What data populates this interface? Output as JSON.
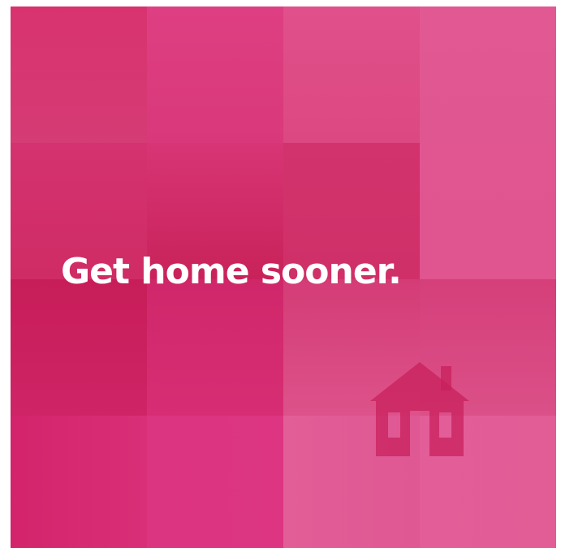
{
  "headline": "Get home sooner.",
  "colors": {
    "background": "#d8336f",
    "text": "#ffffff",
    "icon": "#c81f5a"
  },
  "icon": "house-icon"
}
